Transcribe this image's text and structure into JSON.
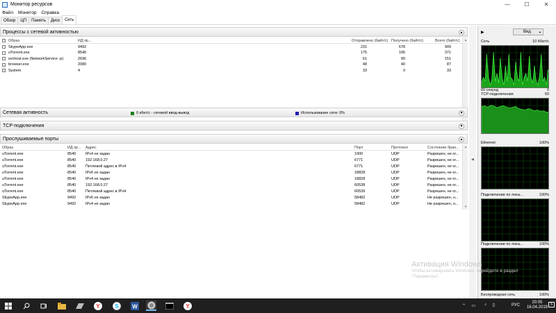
{
  "window": {
    "title": "Монитор ресурсов",
    "minimize": "—",
    "maximize": "☐",
    "close": "✕"
  },
  "menu": [
    "Файл",
    "Монитор",
    "Справка"
  ],
  "tabs": [
    {
      "label": "Обзор",
      "active": false
    },
    {
      "label": "ЦП",
      "active": false
    },
    {
      "label": "Память",
      "active": false
    },
    {
      "label": "Диск",
      "active": false
    },
    {
      "label": "Сеть",
      "active": true
    }
  ],
  "processes": {
    "title": "Процессы с сетевой активностью",
    "columns": [
      "Образ",
      "ИД пр...",
      "Отправлено (байт/с)",
      "Получено (байт/с)",
      "Всего (байт/с)"
    ],
    "rows": [
      [
        "SkypeApp.exe",
        "9492",
        "231",
        "678",
        "909"
      ],
      [
        "uTorrent.exe",
        "8540",
        "175",
        "195",
        "371"
      ],
      [
        "svchost.exe (NetworkService -p)",
        "2696",
        "61",
        "90",
        "151"
      ],
      [
        "browser.exe",
        "2080",
        "48",
        "40",
        "87"
      ],
      [
        "System",
        "4",
        "33",
        "0",
        "33"
      ]
    ]
  },
  "network_activity": {
    "title": "Сетевая активность",
    "legend_io": "0 кбит/с - сетевой ввод-вывод",
    "legend_usage": "Использование сети: 0%",
    "io_color": "#1a7f1a",
    "usage_color": "#1c1cb0"
  },
  "tcp": {
    "title": "TCP-подключения"
  },
  "ports": {
    "title": "Прослушиваемые порты",
    "columns": [
      "Образ",
      "ИД пр...",
      "Адрес",
      "Порт",
      "Протокол",
      "Состояние бран..."
    ],
    "rows": [
      [
        "uTorrent.exe",
        "8540",
        "IPv4 не задан",
        "1900",
        "UDP",
        "Разрешен, не ог..."
      ],
      [
        "uTorrent.exe",
        "8540",
        "192.168.0.27",
        "6771",
        "UDP",
        "Разрешен, не ог..."
      ],
      [
        "uTorrent.exe",
        "8540",
        "Петлевой адрес в IPv4",
        "6771",
        "UDP",
        "Разрешен, не ог..."
      ],
      [
        "uTorrent.exe",
        "8540",
        "IPv6 не задан",
        "18828",
        "UDP",
        "Разрешен, не ог..."
      ],
      [
        "uTorrent.exe",
        "8540",
        "IPv4 не задан",
        "18828",
        "UDP",
        "Разрешен, не ог..."
      ],
      [
        "uTorrent.exe",
        "8540",
        "192.168.0.27",
        "60538",
        "UDP",
        "Разрешен, не ог..."
      ],
      [
        "uTorrent.exe",
        "8540",
        "Петлевой адрес в IPv4",
        "60539",
        "UDP",
        "Разрешен, не ог..."
      ],
      [
        "SkypeApp.exe",
        "9492",
        "IPv6 не задан",
        "58482",
        "UDP",
        "Не разрешен, н..."
      ],
      [
        "SkypeApp.exe",
        "9492",
        "IPv4 не задан",
        "58482",
        "UDP",
        "Не разрешен, н..."
      ]
    ]
  },
  "right_panel": {
    "view_label": "Вид",
    "arrow": "▶",
    "graphs": [
      {
        "left": "Сеть",
        "right": "10 Кбит/с",
        "bottom_left": "60 секунд",
        "bottom_right": "0"
      },
      {
        "left": "TCP-подключения",
        "right": "50",
        "bottom_left": "",
        "bottom_right": ""
      },
      {
        "left": "Ethernet",
        "right": "100%",
        "bottom_left": "",
        "bottom_right": ""
      },
      {
        "left": "Подключение по лока...",
        "right": "100%",
        "bottom_left": "",
        "bottom_right": ""
      },
      {
        "left": "Подключение по лока...",
        "right": "100%",
        "bottom_left": "",
        "bottom_right": ""
      },
      {
        "left": "Беспроводная сеть",
        "right": "100%",
        "bottom_left": "",
        "bottom_right": ""
      }
    ]
  },
  "watermark": {
    "title": "Активация Windows",
    "line1": "Чтобы активировать Windows, перейдите в раздел",
    "line2": "\"Параметры\"."
  },
  "taskbar": {
    "lang": "РУС",
    "time": "20:05",
    "date": "16.04.2019",
    "notifications": "5"
  }
}
